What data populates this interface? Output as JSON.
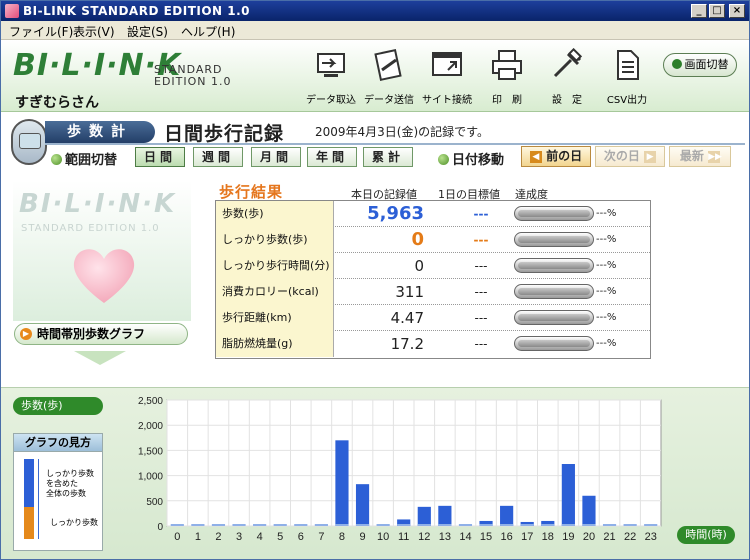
{
  "window": {
    "title": "BI-LINK STANDARD EDITION 1.0",
    "minimize": "_",
    "maximize": "□",
    "close": "×"
  },
  "menu": [
    "ファイル(F)",
    "表示(V)",
    "設定(S)",
    "ヘルプ(H)"
  ],
  "header": {
    "logo": "BI·L·I·N·K",
    "logo_sub_1": "STANDARD",
    "logo_sub_2": "EDITION 1.0",
    "username": "すぎむらさん",
    "tools": [
      {
        "label": "データ取込",
        "icon": "data-import-icon"
      },
      {
        "label": "データ送信",
        "icon": "data-send-icon"
      },
      {
        "label": "サイト接続",
        "icon": "site-connect-icon"
      },
      {
        "label": "印　刷",
        "icon": "printer-icon"
      },
      {
        "label": "設　定",
        "icon": "settings-icon"
      },
      {
        "label": "CSV出力",
        "icon": "csv-export-icon"
      }
    ],
    "switch_screen": "画面切替"
  },
  "nav": {
    "section": "歩数計",
    "page_title": "日間歩行記録",
    "record_date": "2009年4月3日(金)の記録です。",
    "range_label": "範囲切替",
    "range_tabs": [
      "日間",
      "週間",
      "月間",
      "年間",
      "累計"
    ],
    "range_active": 0,
    "date_move_label": "日付移動",
    "prev_day": "前の日",
    "next_day": "次の日",
    "latest": "最新"
  },
  "results": {
    "title": "歩行結果",
    "col_today": "本日の記録値",
    "col_goal": "1日の目標値",
    "col_rate": "達成度",
    "rows": [
      {
        "label": "歩数(歩)",
        "value": "5,963",
        "goal": "---",
        "rate": "---%"
      },
      {
        "label": "しっかり歩数(歩)",
        "value": "0",
        "goal": "---",
        "rate": "---%"
      },
      {
        "label": "しっかり歩行時間(分)",
        "value": "0",
        "goal": "---",
        "rate": "---%"
      },
      {
        "label": "消費カロリー(kcal)",
        "value": "311",
        "goal": "---",
        "rate": "---%"
      },
      {
        "label": "歩行距離(km)",
        "value": "4.47",
        "goal": "---",
        "rate": "---%"
      },
      {
        "label": "脂肪燃焼量(g)",
        "value": "17.2",
        "goal": "---",
        "rate": "---%"
      }
    ],
    "art_logo": "BI·L·I·N·K",
    "art_sub": "STANDARD EDITION 1.0",
    "hourly_button": "時間帯別歩数グラフ"
  },
  "bottom": {
    "steps_label": "歩数(歩)",
    "howto_title": "グラフの見方",
    "howto_text_1": "しっかり歩数\nを含めた\n全体の歩数",
    "howto_text_2": "しっかり歩数",
    "time_label": "時間(時)"
  },
  "colors": {
    "bar_blue": "#2c5fd6",
    "strong_orange": "#e5891b",
    "accent_green": "#2f8a2a"
  },
  "chart_data": {
    "type": "bar",
    "categories": [
      "0",
      "1",
      "2",
      "3",
      "4",
      "5",
      "6",
      "7",
      "8",
      "9",
      "10",
      "11",
      "12",
      "13",
      "14",
      "15",
      "16",
      "17",
      "18",
      "19",
      "20",
      "21",
      "22",
      "23"
    ],
    "series": [
      {
        "values": [
          0,
          0,
          0,
          0,
          0,
          0,
          0,
          0,
          1700,
          830,
          0,
          130,
          380,
          400,
          0,
          100,
          400,
          80,
          100,
          1230,
          600,
          0,
          0,
          0
        ]
      }
    ],
    "ylim": [
      0,
      2500
    ],
    "yticks": [
      "0",
      "500",
      "1,000",
      "1,500",
      "2,000",
      "2,500"
    ],
    "grid": true
  }
}
